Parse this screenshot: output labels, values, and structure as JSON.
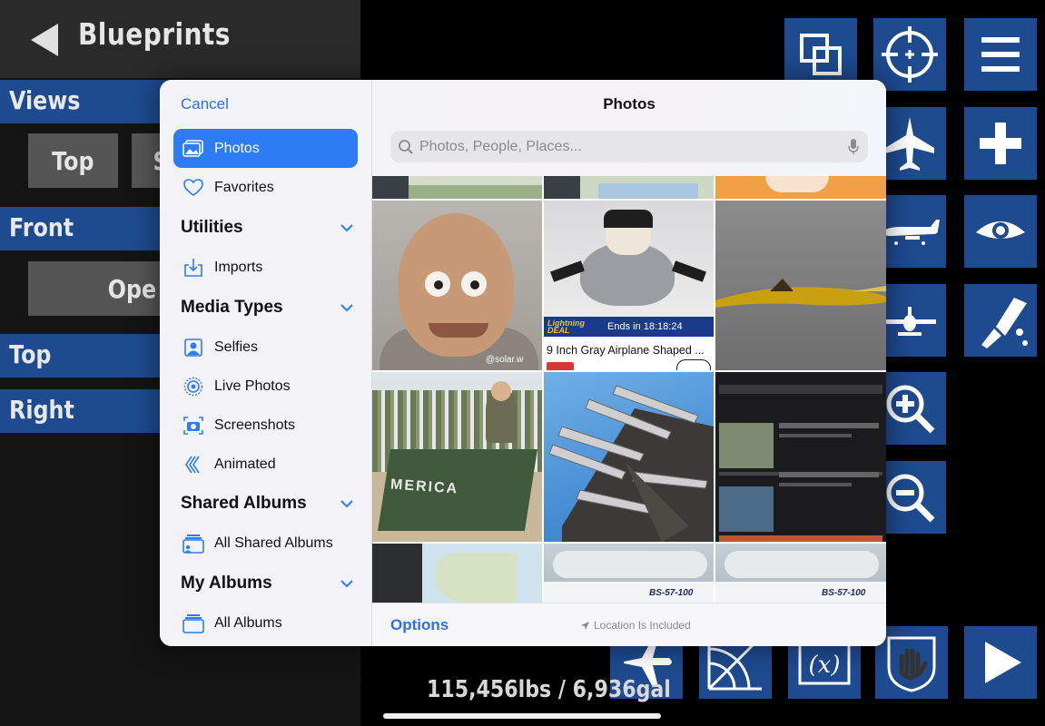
{
  "app": {
    "header_title": "Blueprints",
    "sections": [
      {
        "label": "Views"
      },
      {
        "label": "Front"
      },
      {
        "label": "Top"
      },
      {
        "label": "Right"
      }
    ],
    "view_buttons": {
      "top": "Top",
      "partial_s": "S",
      "open_partial": "Ope"
    },
    "weight_readout": "115,456lbs / 6,936gal"
  },
  "picker": {
    "cancel": "Cancel",
    "sidebar": {
      "items": [
        {
          "label": "Photos",
          "icon": "photos-icon",
          "active": true
        },
        {
          "label": "Favorites",
          "icon": "heart-icon"
        }
      ],
      "utilities": {
        "header": "Utilities",
        "items": [
          {
            "label": "Imports",
            "icon": "import-icon"
          }
        ]
      },
      "media_types": {
        "header": "Media Types",
        "items": [
          {
            "label": "Selfies",
            "icon": "selfie-icon"
          },
          {
            "label": "Live Photos",
            "icon": "live-photo-icon"
          },
          {
            "label": "Screenshots",
            "icon": "screenshot-icon"
          },
          {
            "label": "Animated",
            "icon": "animated-icon"
          }
        ]
      },
      "shared_albums": {
        "header": "Shared Albums",
        "items": [
          {
            "label": "All Shared Albums",
            "icon": "shared-albums-icon"
          }
        ]
      },
      "my_albums": {
        "header": "My Albums",
        "items": [
          {
            "label": "All Albums",
            "icon": "albums-icon"
          }
        ]
      }
    },
    "title": "Photos",
    "search_placeholder": "Photos, People, Places...",
    "grid": {
      "deal_badge": "Lightning DEAL",
      "deal_timer": "Ends in 18:18:24",
      "product_caption": "9 Inch Gray Airplane Shaped ...",
      "watermark": "@solar.w",
      "tank_text": "MERICA",
      "model_label": "BS-57-100",
      "model_label_2": "BS-57-100"
    },
    "options": "Options",
    "location_note": "Location Is Included"
  }
}
